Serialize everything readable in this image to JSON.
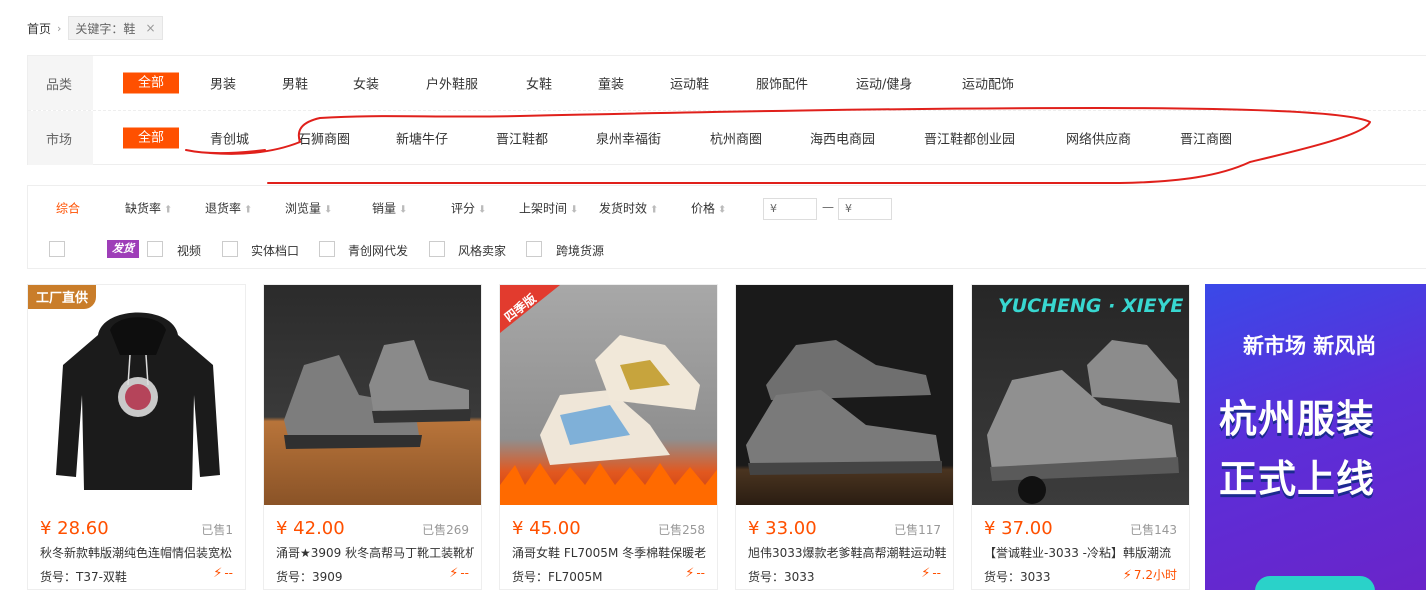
{
  "breadcrumb": {
    "home": "首页",
    "keyword_tag": "关键字：鞋"
  },
  "filters": {
    "category": {
      "label": "品类",
      "options": [
        "全部",
        "男装",
        "男鞋",
        "女装",
        "户外鞋服",
        "女鞋",
        "童装",
        "运动鞋",
        "服饰配件",
        "运动/健身",
        "运动配饰"
      ],
      "selected": "全部"
    },
    "market": {
      "label": "市场",
      "options": [
        "全部",
        "青创城",
        "石狮商圈",
        "新塘牛仔",
        "晋江鞋都",
        "泉州幸福街",
        "杭州商圈",
        "海西电商园",
        "晋江鞋都创业园",
        "网络供应商",
        "晋江商圈"
      ],
      "selected": "全部"
    }
  },
  "sort": {
    "items": [
      "综合",
      "缺货率",
      "退货率",
      "浏览量",
      "销量",
      "评分",
      "上架时间",
      "发货时效",
      "价格"
    ],
    "active": "综合",
    "price_min_placeholder": "¥",
    "price_max_placeholder": "¥",
    "range_dash": "—"
  },
  "checks": {
    "faj_badge": "发货",
    "items": [
      "视频",
      "实体档口",
      "青创网代发",
      "风格卖家",
      "跨境货源"
    ]
  },
  "products": [
    {
      "price": "¥ 28.60",
      "sold": "已售1",
      "title": "秋冬新款韩版潮纯色连帽情侣装宽松",
      "sku": "货号：T37-双鞋",
      "ship": "--",
      "badge": "工厂直供"
    },
    {
      "price": "¥ 42.00",
      "sold": "已售269",
      "title": "涌哥★3909 秋冬高帮马丁靴工装靴机",
      "sku": "货号：3909",
      "ship": "--"
    },
    {
      "price": "¥ 45.00",
      "sold": "已售258",
      "title": "涌哥女鞋 FL7005M 冬季棉鞋保暖老",
      "sku": "货号：FL7005M",
      "ship": "--",
      "badge": "四季版"
    },
    {
      "price": "¥ 33.00",
      "sold": "已售117",
      "title": "旭伟3033爆款老爹鞋高帮潮鞋运动鞋",
      "sku": "货号：3033",
      "ship": "--"
    },
    {
      "price": "¥ 37.00",
      "sold": "已售143",
      "title": "【誉诚鞋业-3033 -冷粘】韩版潮流",
      "sku": "货号：3033",
      "ship": "7.2小时",
      "img_text": "YUCHENG · XIEYE"
    }
  ],
  "ad": {
    "subtitle": "新市场 新风尚",
    "line1": "杭州服装",
    "line2": "正式上线"
  },
  "colors": {
    "accent": "#ff5000",
    "annotation": "#e0201b",
    "ad_bg": "#4a39e0"
  }
}
